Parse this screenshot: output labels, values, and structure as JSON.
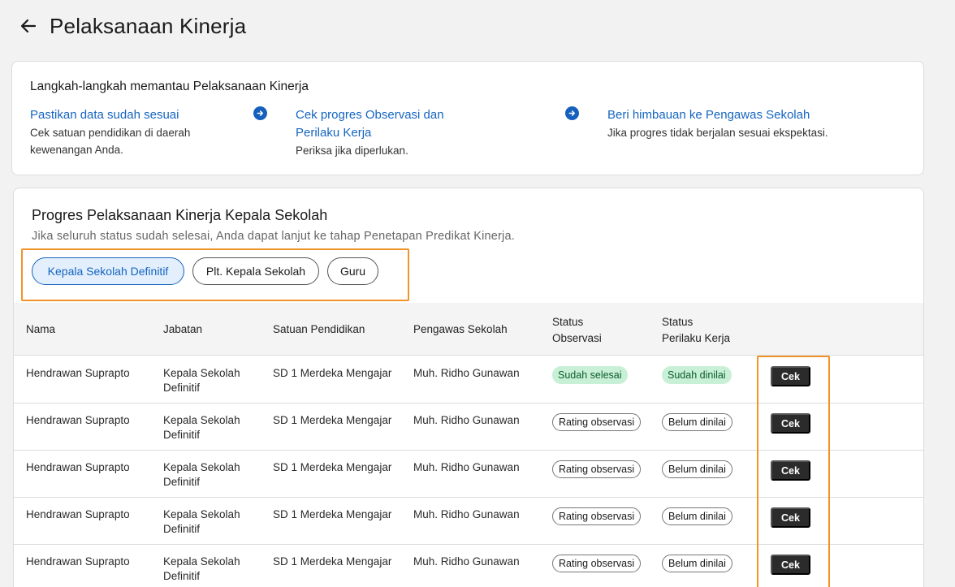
{
  "header": {
    "title": "Pelaksanaan Kinerja",
    "back_icon": "arrow-left-icon"
  },
  "steps": {
    "title": "Langkah-langkah memantau Pelaksanaan Kinerja",
    "items": [
      {
        "title": "Pastikan data sudah sesuai",
        "desc_line1": "Cek satuan pendidikan di daerah",
        "desc_line2": "kewenangan Anda."
      },
      {
        "title_line1": "Cek progres Observasi dan",
        "title_line2": "Perilaku Kerja",
        "desc": "Periksa jika diperlukan."
      },
      {
        "title": "Beri himbauan ke Pengawas Sekolah",
        "desc": "Jika progres tidak berjalan sesuai ekspektasi."
      }
    ],
    "arrow_icon": "arrow-right-circle-icon",
    "accent_color": "#1565c0"
  },
  "progress": {
    "title": "Progres Pelaksanaan Kinerja Kepala Sekolah",
    "subtitle": "Jika seluruh status sudah selesai, Anda dapat lanjut ke tahap Penetapan Predikat Kinerja.",
    "tabs": [
      {
        "label": "Kepala Sekolah Definitif",
        "active": true
      },
      {
        "label": "Plt. Kepala Sekolah",
        "active": false
      },
      {
        "label": "Guru",
        "active": false
      }
    ],
    "columns": {
      "nama": "Nama",
      "jabatan": "Jabatan",
      "satuan": "Satuan Pendidikan",
      "pengawas": "Pengawas Sekolah",
      "obs_line1": "Status",
      "obs_line2": "Observasi",
      "perilaku_line1": "Status",
      "perilaku_line2": "Perilaku Kerja"
    },
    "rows": [
      {
        "nama": "Hendrawan Suprapto",
        "jabatan_line1": "Kepala Sekolah",
        "jabatan_line2": "Definitif",
        "satuan": "SD 1 Merdeka Mengajar",
        "pengawas": "Muh. Ridho Gunawan",
        "observasi": "Sudah selesai",
        "perilaku": "Sudah dinilai",
        "action": "Cek"
      },
      {
        "nama": "Hendrawan Suprapto",
        "jabatan_line1": "Kepala Sekolah",
        "jabatan_line2": "Definitif",
        "satuan": "SD 1 Merdeka Mengajar",
        "pengawas": "Muh. Ridho Gunawan",
        "observasi": "Rating observasi",
        "perilaku": "Belum dinilai",
        "action": "Cek"
      },
      {
        "nama": "Hendrawan Suprapto",
        "jabatan_line1": "Kepala Sekolah",
        "jabatan_line2": "Definitif",
        "satuan": "SD 1 Merdeka Mengajar",
        "pengawas": "Muh. Ridho Gunawan",
        "observasi": "Rating observasi",
        "perilaku": "Belum dinilai",
        "action": "Cek"
      },
      {
        "nama": "Hendrawan Suprapto",
        "jabatan_line1": "Kepala Sekolah",
        "jabatan_line2": "Definitif",
        "satuan": "SD 1 Merdeka Mengajar",
        "pengawas": "Muh. Ridho Gunawan",
        "observasi": "Rating observasi",
        "perilaku": "Belum dinilai",
        "action": "Cek"
      },
      {
        "nama": "Hendrawan Suprapto",
        "jabatan_line1": "Kepala Sekolah",
        "jabatan_line2": "Definitif",
        "satuan": "SD 1 Merdeka Mengajar",
        "pengawas": "Muh. Ridho Gunawan",
        "observasi": "Rating observasi",
        "perilaku": "Belum dinilai",
        "action": "Cek"
      }
    ],
    "status_colors": {
      "done_bg": "#c8f0d6",
      "done_text": "#0d5b2c"
    },
    "highlight_color": "#f0932b"
  }
}
